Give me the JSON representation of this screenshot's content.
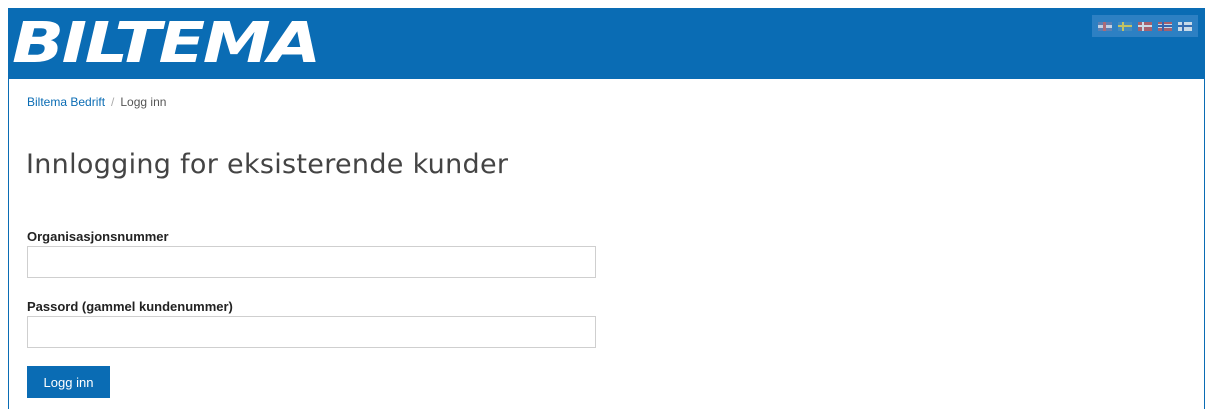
{
  "header": {
    "logo_text": "BILTEMA",
    "brand_color": "#0a6cb4",
    "language_flags": [
      {
        "code": "en",
        "icon": "gb-flag-icon"
      },
      {
        "code": "sv",
        "icon": "se-flag-icon"
      },
      {
        "code": "da",
        "icon": "dk-flag-icon"
      },
      {
        "code": "no",
        "icon": "no-flag-icon"
      },
      {
        "code": "fi",
        "icon": "fi-flag-icon"
      }
    ]
  },
  "breadcrumb": {
    "home_label": "Biltema Bedrift",
    "separator": "/",
    "current_label": "Logg inn"
  },
  "page": {
    "title": "Innlogging for eksisterende kunder"
  },
  "form": {
    "org_label": "Organisasjonsnummer",
    "org_value": "",
    "org_placeholder": "",
    "password_label": "Passord (gammel kundenummer)",
    "password_value": "",
    "password_placeholder": "",
    "submit_label": "Logg inn"
  }
}
